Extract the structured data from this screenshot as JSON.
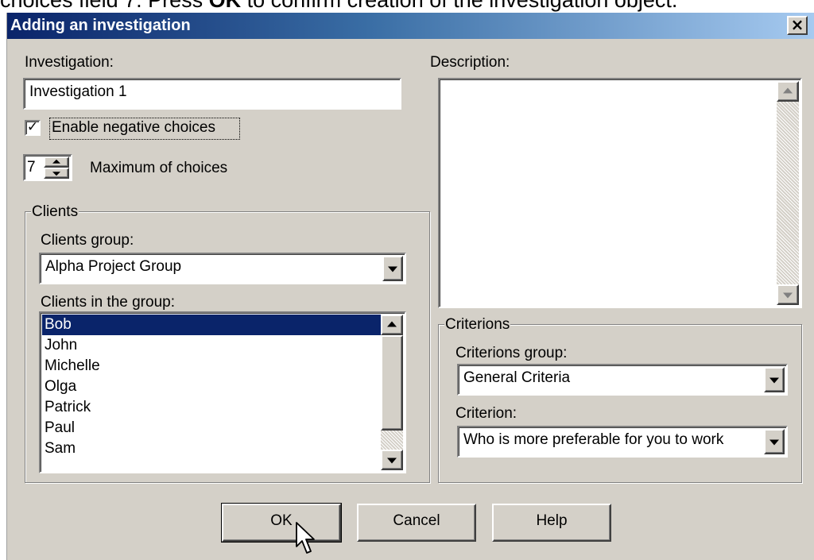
{
  "caption": {
    "pre": "choices field 7. Press ",
    "bold": "OK",
    "post": " to confirm creation of the investigation object."
  },
  "dialog": {
    "title": "Adding an investigation",
    "close_glyph": "×"
  },
  "investigation": {
    "label": "Investigation:",
    "value": "Investigation 1"
  },
  "negative_choices": {
    "label": "Enable negative choices",
    "checked": true,
    "check_glyph": "✓"
  },
  "max_choices": {
    "value": "7",
    "label": "Maximum of choices"
  },
  "clients": {
    "group_title": "Clients",
    "group_label": "Clients group:",
    "group_value": "Alpha Project Group",
    "list_label": "Clients in the group:",
    "items": [
      "Bob",
      "John",
      "Michelle",
      "Olga",
      "Patrick",
      "Paul",
      "Sam"
    ],
    "selected": "Bob"
  },
  "description": {
    "label": "Description:",
    "value": ""
  },
  "criterions": {
    "group_title": "Criterions",
    "group_label": "Criterions group:",
    "group_value": "General Criteria",
    "criterion_label": "Criterion:",
    "criterion_value": "Who is more preferable for you to work"
  },
  "buttons": {
    "ok": "OK",
    "cancel": "Cancel",
    "help": "Help"
  },
  "colors": {
    "face": "#d4d0c8",
    "title_start": "#0a246a",
    "title_end": "#a6caf0",
    "selection": "#0a246a"
  }
}
